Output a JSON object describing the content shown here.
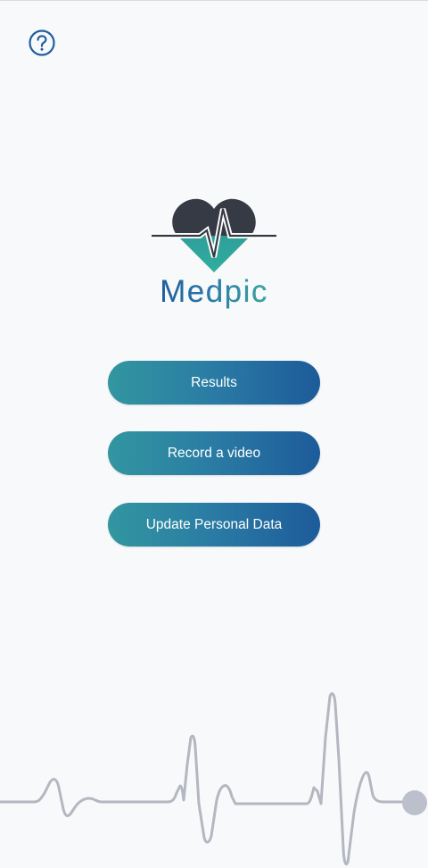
{
  "app": {
    "brand_name": "Medpic",
    "colors": {
      "background": "#f8f9fa",
      "button_gradient_start": "#3296a0",
      "button_gradient_end": "#1d5b9a",
      "button_text": "#ffffff",
      "heart_top": "#363a44",
      "heart_bottom": "#2aa39d",
      "help_icon": "#1f5f9e",
      "ecg_line": "#b4b7c0"
    }
  },
  "header": {
    "help_icon": "question-circle-icon"
  },
  "logo": {
    "icon": "heart-pulse-logo-icon"
  },
  "menu": {
    "results_label": "Results",
    "record_label": "Record a video",
    "update_label": "Update Personal Data"
  },
  "decoration": {
    "ecg_icon": "heartbeat-ecg-line"
  }
}
